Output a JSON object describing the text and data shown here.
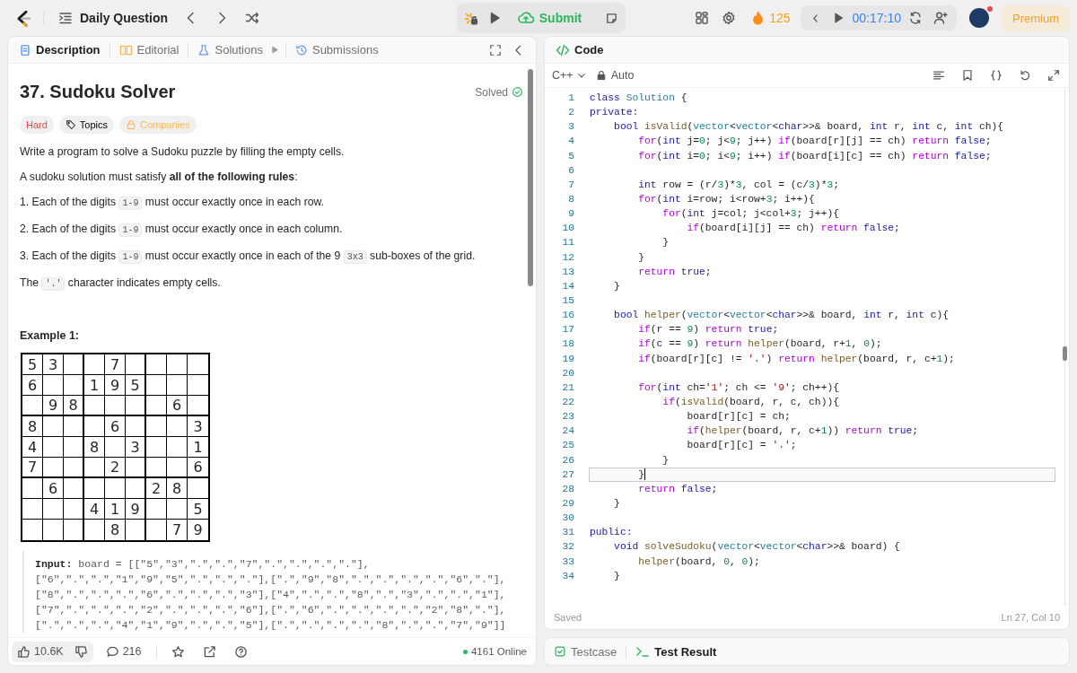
{
  "top_bar": {
    "title": "Daily Question",
    "submit": "Submit",
    "streak": "125",
    "timer": "00:17:10",
    "premium": "Premium",
    "notification": true
  },
  "left_tabs": [
    {
      "label": "Description",
      "kind": "doc",
      "selected": true
    },
    {
      "label": "Editorial",
      "kind": "book",
      "selected": false
    },
    {
      "label": "Solutions",
      "kind": "flask",
      "selected": false
    },
    {
      "label": "Submissions",
      "kind": "history",
      "selected": false
    }
  ],
  "problem": {
    "title": "37. Sudoku Solver",
    "status": "Solved",
    "difficulty": "Hard",
    "tags": [
      {
        "label": "Topics",
        "kind": "tag"
      },
      {
        "label": "Companies",
        "kind": "lock"
      }
    ],
    "paragraphs": [
      [
        {
          "text": "Write a program to solve a Sudoku puzzle by filling the empty cells."
        }
      ],
      [
        {
          "text": "A sudoku solution must satisfy **all of the following rules**:"
        }
      ],
      [
        {
          "text": "1. Each of the digits "
        },
        {
          "text": "1-9",
          "kind": "code"
        },
        {
          "text": " must occur exactly once in each row."
        }
      ],
      [
        {
          "text": "2. Each of the digits "
        },
        {
          "text": "1-9",
          "kind": "code"
        },
        {
          "text": " must occur exactly once in each column."
        }
      ],
      [
        {
          "text": "3. Each of the digits "
        },
        {
          "text": "1-9",
          "kind": "code"
        },
        {
          "text": " must occur exactly once in each of the 9 "
        },
        {
          "text": "3x3",
          "kind": "code"
        },
        {
          "text": " sub-boxes of the grid."
        }
      ],
      [
        {
          "text": "The "
        },
        {
          "text": "'.'",
          "kind": "code"
        },
        {
          "text": " character indicates empty cells."
        }
      ]
    ],
    "example_title": "Example 1:",
    "grid": [
      [
        {
          "kind": "digit",
          "digit": "5"
        },
        {
          "kind": "digit",
          "digit": "3"
        },
        {
          "kind": "empty"
        },
        {
          "kind": "empty"
        },
        {
          "kind": "digit",
          "digit": "7"
        },
        {
          "kind": "empty"
        },
        {
          "kind": "empty"
        },
        {
          "kind": "empty"
        },
        {
          "kind": "empty"
        }
      ],
      [
        {
          "kind": "digit",
          "digit": "6"
        },
        {
          "kind": "empty"
        },
        {
          "kind": "empty"
        },
        {
          "kind": "digit",
          "digit": "1"
        },
        {
          "kind": "digit",
          "digit": "9"
        },
        {
          "kind": "digit",
          "digit": "5"
        },
        {
          "kind": "empty"
        },
        {
          "kind": "empty"
        },
        {
          "kind": "empty"
        }
      ],
      [
        {
          "kind": "empty"
        },
        {
          "kind": "digit",
          "digit": "9"
        },
        {
          "kind": "digit",
          "digit": "8"
        },
        {
          "kind": "empty"
        },
        {
          "kind": "empty"
        },
        {
          "kind": "empty"
        },
        {
          "kind": "empty"
        },
        {
          "kind": "digit",
          "digit": "6"
        },
        {
          "kind": "empty"
        }
      ],
      [
        {
          "kind": "digit",
          "digit": "8"
        },
        {
          "kind": "empty"
        },
        {
          "kind": "empty"
        },
        {
          "kind": "empty"
        },
        {
          "kind": "digit",
          "digit": "6"
        },
        {
          "kind": "empty"
        },
        {
          "kind": "empty"
        },
        {
          "kind": "empty"
        },
        {
          "kind": "digit",
          "digit": "3"
        }
      ],
      [
        {
          "kind": "digit",
          "digit": "4"
        },
        {
          "kind": "empty"
        },
        {
          "kind": "empty"
        },
        {
          "kind": "digit",
          "digit": "8"
        },
        {
          "kind": "empty"
        },
        {
          "kind": "digit",
          "digit": "3"
        },
        {
          "kind": "empty"
        },
        {
          "kind": "empty"
        },
        {
          "kind": "digit",
          "digit": "1"
        }
      ],
      [
        {
          "kind": "digit",
          "digit": "7"
        },
        {
          "kind": "empty"
        },
        {
          "kind": "empty"
        },
        {
          "kind": "empty"
        },
        {
          "kind": "digit",
          "digit": "2"
        },
        {
          "kind": "empty"
        },
        {
          "kind": "empty"
        },
        {
          "kind": "empty"
        },
        {
          "kind": "digit",
          "digit": "6"
        }
      ],
      [
        {
          "kind": "empty"
        },
        {
          "kind": "digit",
          "digit": "6"
        },
        {
          "kind": "empty"
        },
        {
          "kind": "empty"
        },
        {
          "kind": "empty"
        },
        {
          "kind": "empty"
        },
        {
          "kind": "digit",
          "digit": "2"
        },
        {
          "kind": "digit",
          "digit": "8"
        },
        {
          "kind": "empty"
        }
      ],
      [
        {
          "kind": "empty"
        },
        {
          "kind": "empty"
        },
        {
          "kind": "empty"
        },
        {
          "kind": "digit",
          "digit": "4"
        },
        {
          "kind": "digit",
          "digit": "1"
        },
        {
          "kind": "digit",
          "digit": "9"
        },
        {
          "kind": "empty"
        },
        {
          "kind": "empty"
        },
        {
          "kind": "digit",
          "digit": "5"
        }
      ],
      [
        {
          "kind": "empty"
        },
        {
          "kind": "empty"
        },
        {
          "kind": "empty"
        },
        {
          "kind": "empty"
        },
        {
          "kind": "digit",
          "digit": "8"
        },
        {
          "kind": "empty"
        },
        {
          "kind": "empty"
        },
        {
          "kind": "digit",
          "digit": "7"
        },
        {
          "kind": "digit",
          "digit": "9"
        }
      ]
    ],
    "example_input": [
      "**Input:** board = [[\"5\",\"3\",\".\",\".\",\"7\",\".\",\".\",\".\",\".\"],",
      "[\"6\",\".\",\".\",\"1\",\"9\",\"5\",\".\",\".\",\".\"],[\".\",\"9\",\"8\",\".\",\".\",\".\",\".\",\"6\",\".\"],",
      "[\"8\",\".\",\".\",\".\",\"6\",\".\",\".\",\".\",\"3\"],[\"4\",\".\",\".\",\"8\",\".\",\"3\",\".\",\".\",\"1\"],",
      "[\"7\",\".\",\".\",\".\",\"2\",\".\",\".\",\".\",\"6\"],[\".\",\"6\",\".\",\".\",\".\",\".\",\"2\",\"8\",\".\"],",
      "[\".\",\".\",\".\",\"4\",\"1\",\"9\",\".\",\".\",\"5\"],[\".\",\".\",\".\",\".\",\"8\",\".\",\".\",\"7\",\"9\"]]"
    ]
  },
  "footer": {
    "likes": "10.6K",
    "comments": "216",
    "online": "4161 Online"
  },
  "code_panel": {
    "title": "Code",
    "language": "C++",
    "mode": "Auto",
    "status": "Saved",
    "position": "Ln 27, Col 10",
    "lines": [
      {
        "n": "1",
        "current": false,
        "s": [
          {
            "t": "class",
            "kind": "keyword"
          },
          {
            "t": " Solution",
            "kind": "type"
          },
          {
            "t": " {"
          }
        ]
      },
      {
        "n": "2",
        "current": false,
        "s": [
          {
            "t": "private:",
            "kind": "keyword"
          }
        ]
      },
      {
        "n": "3",
        "current": false,
        "s": [
          {
            "t": "    bool",
            "kind": "keyword"
          },
          {
            "t": " isValid",
            "kind": "function"
          },
          {
            "t": "("
          },
          {
            "t": "vector",
            "kind": "type"
          },
          {
            "t": "<"
          },
          {
            "t": "vector",
            "kind": "type"
          },
          {
            "t": "<"
          },
          {
            "t": "char",
            "kind": "keyword"
          },
          {
            "t": ">>& board, "
          },
          {
            "t": "int",
            "kind": "keyword"
          },
          {
            "t": " r, "
          },
          {
            "t": "int",
            "kind": "keyword"
          },
          {
            "t": " c, "
          },
          {
            "t": "int",
            "kind": "keyword"
          },
          {
            "t": " ch){"
          }
        ]
      },
      {
        "n": "4",
        "current": false,
        "s": [
          {
            "t": "        for",
            "kind": "control"
          },
          {
            "t": "("
          },
          {
            "t": "int",
            "kind": "keyword"
          },
          {
            "t": " j="
          },
          {
            "t": "0",
            "kind": "number"
          },
          {
            "t": "; j<"
          },
          {
            "t": "9",
            "kind": "number"
          },
          {
            "t": "; j++) "
          },
          {
            "t": "if",
            "kind": "control"
          },
          {
            "t": "(board[r][j] == ch) "
          },
          {
            "t": "return",
            "kind": "control"
          },
          {
            "t": " false",
            "kind": "keyword"
          },
          {
            "t": ";"
          }
        ]
      },
      {
        "n": "5",
        "current": false,
        "s": [
          {
            "t": "        for",
            "kind": "control"
          },
          {
            "t": "("
          },
          {
            "t": "int",
            "kind": "keyword"
          },
          {
            "t": " i="
          },
          {
            "t": "0",
            "kind": "number"
          },
          {
            "t": "; i<"
          },
          {
            "t": "9",
            "kind": "number"
          },
          {
            "t": "; i++) "
          },
          {
            "t": "if",
            "kind": "control"
          },
          {
            "t": "(board[i][c] == ch) "
          },
          {
            "t": "return",
            "kind": "control"
          },
          {
            "t": " false",
            "kind": "keyword"
          },
          {
            "t": ";"
          }
        ]
      },
      {
        "n": "6",
        "current": false
      },
      {
        "n": "7",
        "current": false,
        "s": [
          {
            "t": "        int",
            "kind": "keyword"
          },
          {
            "t": " row = (r/"
          },
          {
            "t": "3",
            "kind": "number"
          },
          {
            "t": ")*"
          },
          {
            "t": "3",
            "kind": "number"
          },
          {
            "t": ", col = (c/"
          },
          {
            "t": "3",
            "kind": "number"
          },
          {
            "t": ")*"
          },
          {
            "t": "3",
            "kind": "number"
          },
          {
            "t": ";"
          }
        ]
      },
      {
        "n": "8",
        "current": false,
        "s": [
          {
            "t": "        for",
            "kind": "control"
          },
          {
            "t": "("
          },
          {
            "t": "int",
            "kind": "keyword"
          },
          {
            "t": " i=row; i<row+"
          },
          {
            "t": "3",
            "kind": "number"
          },
          {
            "t": "; i++){"
          }
        ]
      },
      {
        "n": "9",
        "current": false,
        "s": [
          {
            "t": "            for",
            "kind": "control"
          },
          {
            "t": "("
          },
          {
            "t": "int",
            "kind": "keyword"
          },
          {
            "t": " j=col; j<col+"
          },
          {
            "t": "3",
            "kind": "number"
          },
          {
            "t": "; j++){"
          }
        ]
      },
      {
        "n": "10",
        "current": false,
        "s": [
          {
            "t": "                if",
            "kind": "control"
          },
          {
            "t": "(board[i][j] == ch) "
          },
          {
            "t": "return",
            "kind": "control"
          },
          {
            "t": " false",
            "kind": "keyword"
          },
          {
            "t": ";"
          }
        ]
      },
      {
        "n": "11",
        "current": false,
        "s": [
          {
            "t": "            }"
          }
        ]
      },
      {
        "n": "12",
        "current": false,
        "s": [
          {
            "t": "        }"
          }
        ]
      },
      {
        "n": "13",
        "current": false,
        "s": [
          {
            "t": "        return",
            "kind": "control"
          },
          {
            "t": " true",
            "kind": "keyword"
          },
          {
            "t": ";"
          }
        ]
      },
      {
        "n": "14",
        "current": false,
        "s": [
          {
            "t": "    }"
          }
        ]
      },
      {
        "n": "15",
        "current": false
      },
      {
        "n": "16",
        "current": false,
        "s": [
          {
            "t": "    bool",
            "kind": "keyword"
          },
          {
            "t": " helper",
            "kind": "function"
          },
          {
            "t": "("
          },
          {
            "t": "vector",
            "kind": "type"
          },
          {
            "t": "<"
          },
          {
            "t": "vector",
            "kind": "type"
          },
          {
            "t": "<"
          },
          {
            "t": "char",
            "kind": "keyword"
          },
          {
            "t": ">>& board, "
          },
          {
            "t": "int",
            "kind": "keyword"
          },
          {
            "t": " r, "
          },
          {
            "t": "int",
            "kind": "keyword"
          },
          {
            "t": " c){"
          }
        ]
      },
      {
        "n": "17",
        "current": false,
        "s": [
          {
            "t": "        if",
            "kind": "control"
          },
          {
            "t": "(r == "
          },
          {
            "t": "9",
            "kind": "number"
          },
          {
            "t": ") "
          },
          {
            "t": "return",
            "kind": "control"
          },
          {
            "t": " true",
            "kind": "keyword"
          },
          {
            "t": ";"
          }
        ]
      },
      {
        "n": "18",
        "current": false,
        "s": [
          {
            "t": "        if",
            "kind": "control"
          },
          {
            "t": "(c == "
          },
          {
            "t": "9",
            "kind": "number"
          },
          {
            "t": ") "
          },
          {
            "t": "return",
            "kind": "control"
          },
          {
            "t": " helper",
            "kind": "function"
          },
          {
            "t": "(board, r+"
          },
          {
            "t": "1",
            "kind": "number"
          },
          {
            "t": ", "
          },
          {
            "t": "0",
            "kind": "number"
          },
          {
            "t": ");"
          }
        ]
      },
      {
        "n": "19",
        "current": false,
        "s": [
          {
            "t": "        if",
            "kind": "control"
          },
          {
            "t": "(board[r][c] != "
          },
          {
            "t": "'.'",
            "kind": "string"
          },
          {
            "t": ") "
          },
          {
            "t": "return",
            "kind": "control"
          },
          {
            "t": " helper",
            "kind": "function"
          },
          {
            "t": "(board, r, c+"
          },
          {
            "t": "1",
            "kind": "number"
          },
          {
            "t": ");"
          }
        ]
      },
      {
        "n": "20",
        "current": false
      },
      {
        "n": "21",
        "current": false,
        "s": [
          {
            "t": "        for",
            "kind": "control"
          },
          {
            "t": "("
          },
          {
            "t": "int",
            "kind": "keyword"
          },
          {
            "t": " ch="
          },
          {
            "t": "'1'",
            "kind": "string"
          },
          {
            "t": "; ch <= "
          },
          {
            "t": "'9'",
            "kind": "string"
          },
          {
            "t": "; ch++){"
          }
        ]
      },
      {
        "n": "22",
        "current": false,
        "s": [
          {
            "t": "            if",
            "kind": "control"
          },
          {
            "t": "("
          },
          {
            "t": "isValid",
            "kind": "function"
          },
          {
            "t": "(board, r, c, ch)){"
          }
        ]
      },
      {
        "n": "23",
        "current": false,
        "s": [
          {
            "t": "                board[r][c] = ch;"
          }
        ]
      },
      {
        "n": "24",
        "current": false,
        "s": [
          {
            "t": "                if",
            "kind": "control"
          },
          {
            "t": "("
          },
          {
            "t": "helper",
            "kind": "function"
          },
          {
            "t": "(board, r, c+"
          },
          {
            "t": "1",
            "kind": "number"
          },
          {
            "t": ")) "
          },
          {
            "t": "return",
            "kind": "control"
          },
          {
            "t": " true",
            "kind": "keyword"
          },
          {
            "t": ";"
          }
        ]
      },
      {
        "n": "25",
        "current": false,
        "s": [
          {
            "t": "                board[r][c] = "
          },
          {
            "t": "'.'",
            "kind": "string"
          },
          {
            "t": ";"
          }
        ]
      },
      {
        "n": "26",
        "current": false,
        "s": [
          {
            "t": "            }"
          }
        ]
      },
      {
        "n": "27",
        "current": true,
        "s": [
          {
            "t": "        }"
          }
        ]
      },
      {
        "n": "28",
        "current": false,
        "s": [
          {
            "t": "        return",
            "kind": "control"
          },
          {
            "t": " false",
            "kind": "keyword"
          },
          {
            "t": ";"
          }
        ]
      },
      {
        "n": "29",
        "current": false,
        "s": [
          {
            "t": "    }"
          }
        ]
      },
      {
        "n": "30",
        "current": false
      },
      {
        "n": "31",
        "current": false,
        "s": [
          {
            "t": "public:",
            "kind": "keyword"
          }
        ]
      },
      {
        "n": "32",
        "current": false,
        "s": [
          {
            "t": "    void",
            "kind": "keyword"
          },
          {
            "t": " solveSudoku",
            "kind": "function"
          },
          {
            "t": "("
          },
          {
            "t": "vector",
            "kind": "type"
          },
          {
            "t": "<"
          },
          {
            "t": "vector",
            "kind": "type"
          },
          {
            "t": "<"
          },
          {
            "t": "char",
            "kind": "keyword"
          },
          {
            "t": ">>& board) {"
          }
        ]
      },
      {
        "n": "33",
        "current": false,
        "s": [
          {
            "t": "        helper",
            "kind": "function"
          },
          {
            "t": "(board, "
          },
          {
            "t": "0",
            "kind": "number"
          },
          {
            "t": ", "
          },
          {
            "t": "0",
            "kind": "number"
          },
          {
            "t": ");"
          }
        ]
      },
      {
        "n": "34",
        "current": false,
        "s": [
          {
            "t": "    }"
          }
        ]
      }
    ]
  },
  "bottom_tabs": [
    {
      "label": "Testcase",
      "kind": "check",
      "selected": false
    },
    {
      "label": "Test Result",
      "kind": "terminal",
      "selected": true
    }
  ]
}
